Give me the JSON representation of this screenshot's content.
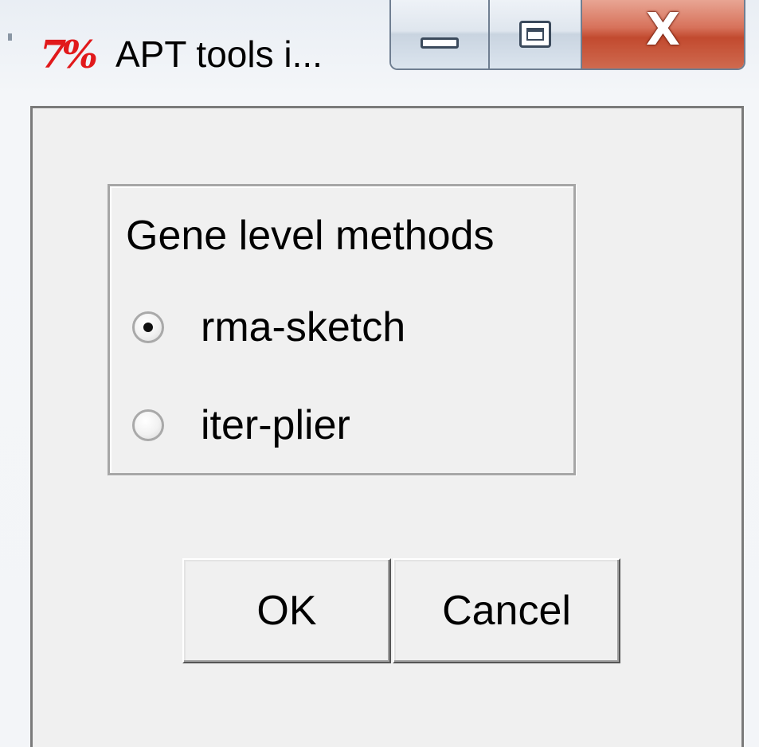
{
  "window": {
    "title": "APT tools i...",
    "icon": "tk-feather-icon",
    "controls": {
      "minimize_icon": "minimize-icon",
      "maximize_icon": "maximize-icon",
      "close_glyph": "X"
    }
  },
  "group": {
    "title": "Gene level methods",
    "options": [
      {
        "label": "rma-sketch",
        "selected": true
      },
      {
        "label": "iter-plier",
        "selected": false
      }
    ]
  },
  "buttons": {
    "ok_label": "OK",
    "cancel_label": "Cancel"
  },
  "colors": {
    "icon_red": "#e1191b",
    "close_button": "#c24a2f",
    "dialog_bg": "#f0f0f0"
  }
}
